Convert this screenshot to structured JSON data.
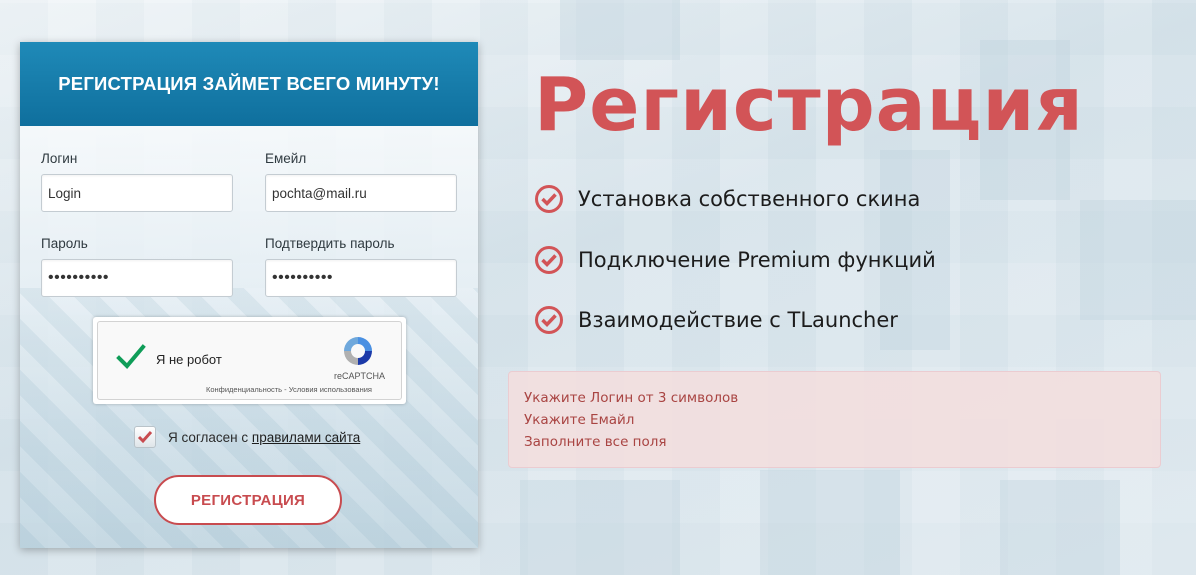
{
  "panel": {
    "header": "РЕГИСТРАЦИЯ ЗАЙМЕТ ВСЕГО МИНУТУ!",
    "login_label": "Логин",
    "login_value": "Login",
    "email_label": "Емейл",
    "email_value": "pochta@mail.ru",
    "password_label": "Пароль",
    "password_value": "••••••••••",
    "confirm_label": "Подтвердить пароль",
    "confirm_value": "••••••••••",
    "captcha": {
      "label": "Я не робот",
      "brand": "reCAPTCHA",
      "links": "Конфиденциальность - Условия использования",
      "checked": true
    },
    "agree_prefix": "Я согласен с",
    "agree_link": "правилами сайта",
    "agree_checked": true,
    "submit_label": "РЕГИСТРАЦИЯ"
  },
  "promo": {
    "title": "Регистрация",
    "features": [
      "Установка собственного скина",
      "Подключение Premium функций",
      "Взаимодействие с TLauncher"
    ],
    "feature_icon": "checkmark-circle-icon"
  },
  "errors": [
    "Укажите Логин от 3 символов",
    "Укажите Емайл",
    "Заполните все поля"
  ],
  "colors": {
    "accent_red": "#d25457",
    "header_blue": "#0f6f9d",
    "error_text": "#a94442",
    "error_bg": "#f2dede"
  }
}
